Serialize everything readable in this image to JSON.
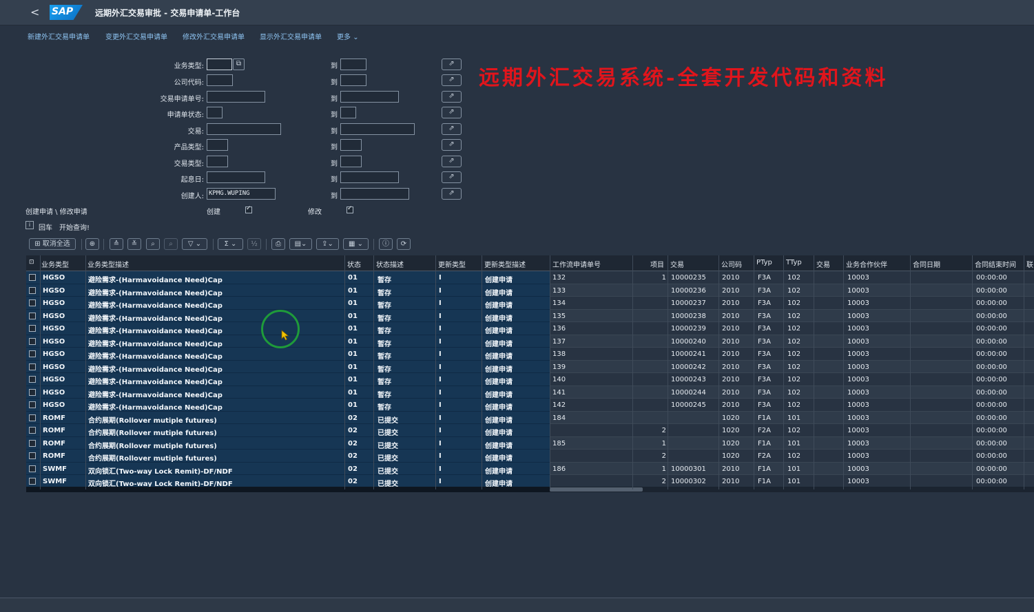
{
  "shell": {
    "back": "<",
    "logo": "SAP",
    "title": "远期外汇交易审批 - 交易申请单-工作台"
  },
  "menu": [
    "新建外汇交易申请单",
    "变更外汇交易申请单",
    "修改外汇交易申请单",
    "显示外汇交易申请单",
    "更多"
  ],
  "form": {
    "fields": [
      {
        "label": "业务类型:",
        "from": "",
        "to": ""
      },
      {
        "label": "公司代码:",
        "from": "",
        "to": ""
      },
      {
        "label": "交易申请单号:",
        "from": "",
        "to": ""
      },
      {
        "label": "申请单状态:",
        "from": "",
        "to": ""
      },
      {
        "label": "交易:",
        "from": "",
        "to": ""
      },
      {
        "label": "产品类型:",
        "from": "",
        "to": ""
      },
      {
        "label": "交易类型:",
        "from": "",
        "to": ""
      },
      {
        "label": "起息日:",
        "from": "",
        "to": ""
      },
      {
        "label": "创建人:",
        "from": "KPMG.WUPING",
        "to": ""
      }
    ],
    "to_label": "到",
    "create_modify_label": "创建申请 \\ 修改申请",
    "create_label": "创建",
    "modify_label": "修改",
    "create_checked": true,
    "modify_checked": true
  },
  "overlay_text": "远期外汇交易系统-全套开发代码和资料",
  "hint": {
    "icon": "i",
    "text1": "回车",
    "text2": "开始查询!"
  },
  "toolbar": {
    "deselect_all": "取消全选"
  },
  "columns_left": [
    "业务类型",
    "业务类型描述",
    "状态",
    "状态描述",
    "更新类型",
    "更新类型描述"
  ],
  "columns_right": [
    "工作流申请单号",
    "项目",
    "交易",
    "公司码",
    "PTyp",
    "TTyp",
    "交易",
    "业务合作伙伴",
    "合同日期",
    "合同结束时间",
    "联"
  ],
  "rows": [
    {
      "bt": "HGSO",
      "desc": "避险需求-(Harmavoidance Need)Cap",
      "st": "01",
      "sd": "暂存",
      "ut": "I",
      "ud": "创建申请",
      "wf": "132",
      "item": "1",
      "deal": "10000235",
      "cc": "2010",
      "pt": "F3A",
      "tt": "102",
      "partner": "10003",
      "end": "00:00:00"
    },
    {
      "bt": "HGSO",
      "desc": "避险需求-(Harmavoidance Need)Cap",
      "st": "01",
      "sd": "暂存",
      "ut": "I",
      "ud": "创建申请",
      "wf": "133",
      "item": "",
      "deal": "10000236",
      "cc": "2010",
      "pt": "F3A",
      "tt": "102",
      "partner": "10003",
      "end": "00:00:00"
    },
    {
      "bt": "HGSO",
      "desc": "避险需求-(Harmavoidance Need)Cap",
      "st": "01",
      "sd": "暂存",
      "ut": "I",
      "ud": "创建申请",
      "wf": "134",
      "item": "",
      "deal": "10000237",
      "cc": "2010",
      "pt": "F3A",
      "tt": "102",
      "partner": "10003",
      "end": "00:00:00"
    },
    {
      "bt": "HGSO",
      "desc": "避险需求-(Harmavoidance Need)Cap",
      "st": "01",
      "sd": "暂存",
      "ut": "I",
      "ud": "创建申请",
      "wf": "135",
      "item": "",
      "deal": "10000238",
      "cc": "2010",
      "pt": "F3A",
      "tt": "102",
      "partner": "10003",
      "end": "00:00:00"
    },
    {
      "bt": "HGSO",
      "desc": "避险需求-(Harmavoidance Need)Cap",
      "st": "01",
      "sd": "暂存",
      "ut": "I",
      "ud": "创建申请",
      "wf": "136",
      "item": "",
      "deal": "10000239",
      "cc": "2010",
      "pt": "F3A",
      "tt": "102",
      "partner": "10003",
      "end": "00:00:00"
    },
    {
      "bt": "HGSO",
      "desc": "避险需求-(Harmavoidance Need)Cap",
      "st": "01",
      "sd": "暂存",
      "ut": "I",
      "ud": "创建申请",
      "wf": "137",
      "item": "",
      "deal": "10000240",
      "cc": "2010",
      "pt": "F3A",
      "tt": "102",
      "partner": "10003",
      "end": "00:00:00"
    },
    {
      "bt": "HGSO",
      "desc": "避险需求-(Harmavoidance Need)Cap",
      "st": "01",
      "sd": "暂存",
      "ut": "I",
      "ud": "创建申请",
      "wf": "138",
      "item": "",
      "deal": "10000241",
      "cc": "2010",
      "pt": "F3A",
      "tt": "102",
      "partner": "10003",
      "end": "00:00:00"
    },
    {
      "bt": "HGSO",
      "desc": "避险需求-(Harmavoidance Need)Cap",
      "st": "01",
      "sd": "暂存",
      "ut": "I",
      "ud": "创建申请",
      "wf": "139",
      "item": "",
      "deal": "10000242",
      "cc": "2010",
      "pt": "F3A",
      "tt": "102",
      "partner": "10003",
      "end": "00:00:00"
    },
    {
      "bt": "HGSO",
      "desc": "避险需求-(Harmavoidance Need)Cap",
      "st": "01",
      "sd": "暂存",
      "ut": "I",
      "ud": "创建申请",
      "wf": "140",
      "item": "",
      "deal": "10000243",
      "cc": "2010",
      "pt": "F3A",
      "tt": "102",
      "partner": "10003",
      "end": "00:00:00"
    },
    {
      "bt": "HGSO",
      "desc": "避险需求-(Harmavoidance Need)Cap",
      "st": "01",
      "sd": "暂存",
      "ut": "I",
      "ud": "创建申请",
      "wf": "141",
      "item": "",
      "deal": "10000244",
      "cc": "2010",
      "pt": "F3A",
      "tt": "102",
      "partner": "10003",
      "end": "00:00:00"
    },
    {
      "bt": "HGSO",
      "desc": "避险需求-(Harmavoidance Need)Cap",
      "st": "01",
      "sd": "暂存",
      "ut": "I",
      "ud": "创建申请",
      "wf": "142",
      "item": "",
      "deal": "10000245",
      "cc": "2010",
      "pt": "F3A",
      "tt": "102",
      "partner": "10003",
      "end": "00:00:00"
    },
    {
      "bt": "ROMF",
      "desc": "合约展期(Rollover mutiple futures)",
      "st": "02",
      "sd": "已提交",
      "ut": "I",
      "ud": "创建申请",
      "wf": "184",
      "item": "",
      "deal": "",
      "cc": "1020",
      "pt": "F1A",
      "tt": "101",
      "partner": "10003",
      "end": "00:00:00"
    },
    {
      "bt": "ROMF",
      "desc": "合约展期(Rollover mutiple futures)",
      "st": "02",
      "sd": "已提交",
      "ut": "I",
      "ud": "创建申请",
      "wf": "",
      "item": "2",
      "deal": "",
      "cc": "1020",
      "pt": "F2A",
      "tt": "102",
      "partner": "10003",
      "end": "00:00:00"
    },
    {
      "bt": "ROMF",
      "desc": "合约展期(Rollover mutiple futures)",
      "st": "02",
      "sd": "已提交",
      "ut": "I",
      "ud": "创建申请",
      "wf": "185",
      "item": "1",
      "deal": "",
      "cc": "1020",
      "pt": "F1A",
      "tt": "101",
      "partner": "10003",
      "end": "00:00:00"
    },
    {
      "bt": "ROMF",
      "desc": "合约展期(Rollover mutiple futures)",
      "st": "02",
      "sd": "已提交",
      "ut": "I",
      "ud": "创建申请",
      "wf": "",
      "item": "2",
      "deal": "",
      "cc": "1020",
      "pt": "F2A",
      "tt": "102",
      "partner": "10003",
      "end": "00:00:00"
    },
    {
      "bt": "SWMF",
      "desc": "双向锁汇(Two-way Lock Remit)-DF/NDF",
      "st": "02",
      "sd": "已提交",
      "ut": "I",
      "ud": "创建申请",
      "wf": "186",
      "item": "1",
      "deal": "10000301",
      "cc": "2010",
      "pt": "F1A",
      "tt": "101",
      "partner": "10003",
      "end": "00:00:00"
    },
    {
      "bt": "SWMF",
      "desc": "双向锁汇(Two-way Lock Remit)-DF/NDF",
      "st": "02",
      "sd": "已提交",
      "ut": "I",
      "ud": "创建申请",
      "wf": "",
      "item": "2",
      "deal": "10000302",
      "cc": "2010",
      "pt": "F1A",
      "tt": "101",
      "partner": "10003",
      "end": "00:00:00"
    }
  ],
  "colors": {
    "selected_row": "#163654",
    "overlay": "#e0151c",
    "link": "#8ec4f2",
    "cursor_ring": "#1f9b3a"
  },
  "icons": [
    "back-icon",
    "value-help-icon",
    "multiple-selection-icon",
    "info-icon",
    "deselect-all-icon",
    "zoom-icon",
    "sort-ascending-icon",
    "sort-descending-icon",
    "find-icon",
    "find-next-icon",
    "filter-icon",
    "sum-icon",
    "subtotal-icon",
    "print-icon",
    "layout-icon",
    "export-icon",
    "view-icon",
    "details-icon",
    "refresh-icon"
  ]
}
